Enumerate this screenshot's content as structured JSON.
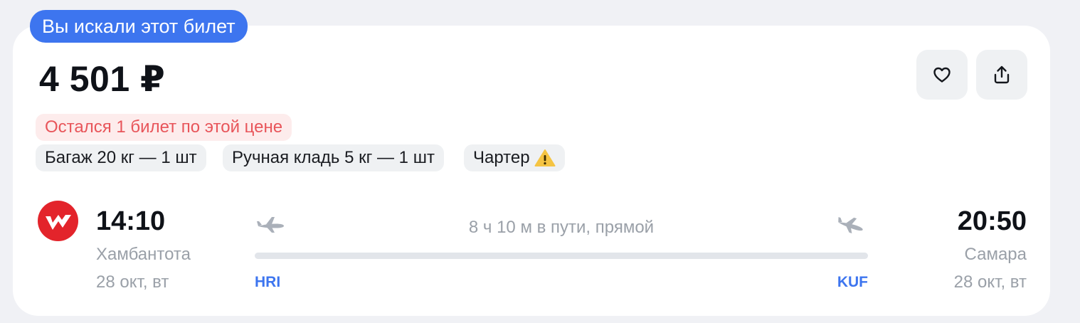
{
  "badge": {
    "label": "Вы искали этот билет"
  },
  "price": {
    "value": "4 501 ₽"
  },
  "actions": {
    "favorite_icon": "heart-icon",
    "share_icon": "share-icon"
  },
  "chips": {
    "warning": "Остался 1 билет по этой цене",
    "baggage": "Багаж 20 кг — 1 шт",
    "hand_luggage": "Ручная кладь 5 кг — 1 шт",
    "charter": "Чартер"
  },
  "flight": {
    "airline_logo": "airline-logo-icon",
    "departure": {
      "time": "14:10",
      "city": "Хамбантота",
      "date": "28 окт, вт",
      "iata": "HRI"
    },
    "arrival": {
      "time": "20:50",
      "city": "Самара",
      "date": "28 окт, вт",
      "iata": "KUF"
    },
    "duration": "8 ч 10 м в пути, прямой"
  },
  "colors": {
    "accent": "#3d75ef",
    "warning_text": "#e8555a",
    "warning_bg": "#fdecec",
    "logo_red": "#e3242b",
    "alert_yellow": "#f5c443"
  }
}
